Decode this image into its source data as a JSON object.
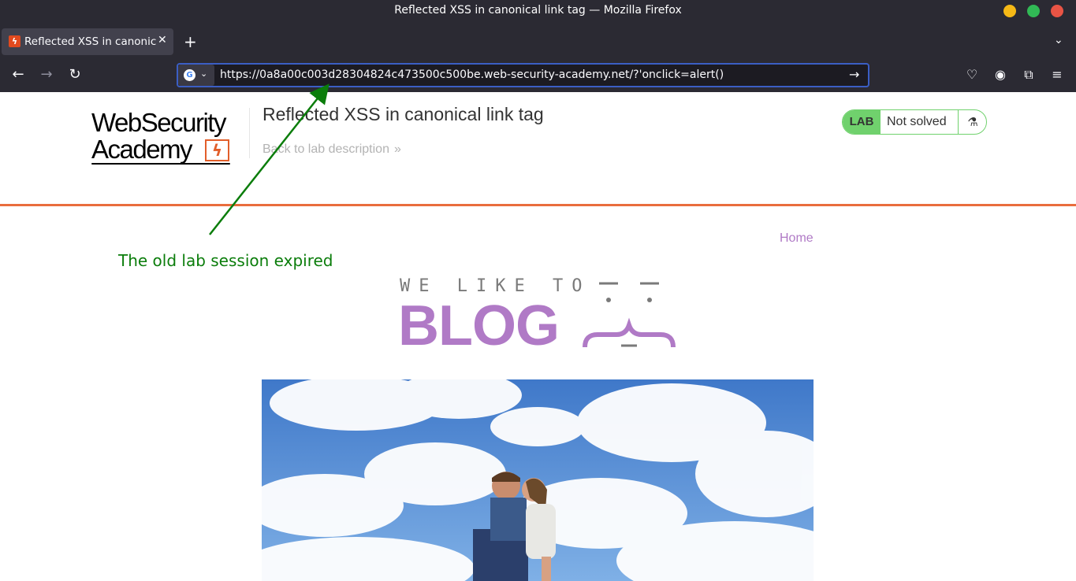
{
  "window": {
    "title": "Reflected XSS in canonical link tag — Mozilla Firefox",
    "controls": [
      "minimize",
      "maximize",
      "close"
    ]
  },
  "tabs": [
    {
      "label": "Reflected XSS in canonical link tag",
      "active": true
    }
  ],
  "navbar": {
    "url": "https://0a8a00c003d28304824c473500c500be.web-security-academy.net/?'onclick=alert()",
    "search_engine": "Google"
  },
  "page": {
    "logo": {
      "line1": "WebSecurity",
      "line2": "Academy"
    },
    "lab_title": "Reflected XSS in canonical link tag",
    "back_link": "Back to lab description",
    "status": {
      "badge": "LAB",
      "text": "Not solved"
    },
    "nav": {
      "home": "Home"
    },
    "blog_logo": {
      "tagline": "WE LIKE TO",
      "word": "BLOG"
    }
  },
  "annotation": {
    "text": "The old lab session expired",
    "color": "#0b7d0b"
  },
  "colors": {
    "accent_orange": "#e96d3d",
    "blog_purple": "#b07ac6",
    "lab_green": "#70d16d",
    "browser_chrome": "#2b2a33"
  }
}
